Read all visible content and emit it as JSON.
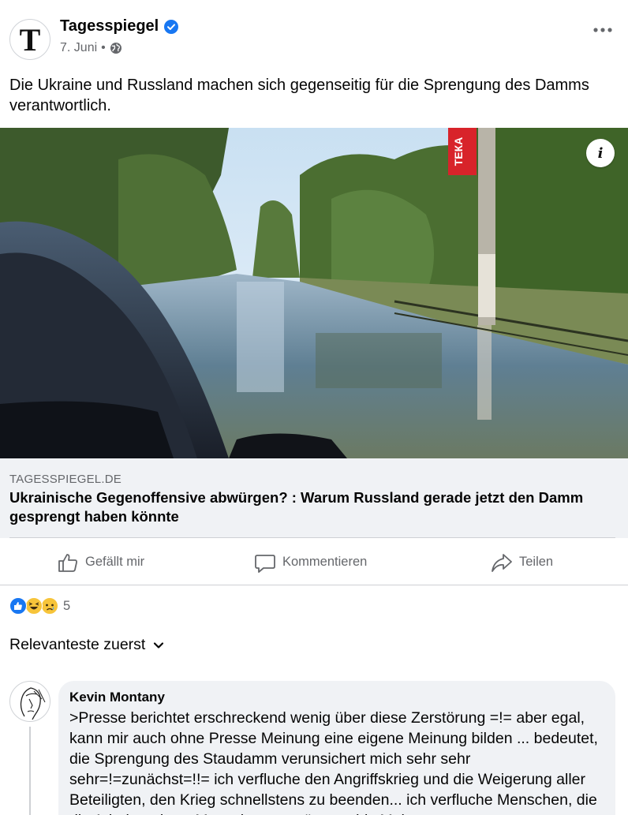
{
  "post": {
    "page_name": "Tagesspiegel",
    "avatar_letter": "T",
    "date": "7. Juni",
    "separator": "•",
    "text": "Die Ukraine und Russland machen sich gegenseitig für die Sprengung des Damms verantwortlich.",
    "image_sign_text": "ТЕКА",
    "info_label": "i"
  },
  "link": {
    "domain": "TAGESSPIEGEL.DE",
    "title": "Ukrainische Gegenoffensive abwürgen? : Warum Russland gerade jetzt den Damm gesprengt haben könnte"
  },
  "actions": {
    "like": "Gefällt mir",
    "comment": "Kommentieren",
    "share": "Teilen"
  },
  "reactions": {
    "types": [
      "like",
      "haha",
      "sad"
    ],
    "count": "5"
  },
  "sort": {
    "label": "Relevanteste zuerst"
  },
  "comment": {
    "author": "Kevin Montany",
    "text": ">Presse berichtet erschreckend wenig über diese Zerstörung =!= aber egal, kann mir auch ohne Presse Meinung eine eigene Meinung bilden ... bedeutet, die Sprengung des Staudamm verunsichert mich sehr sehr sehr=!=zunächst=!!= ich verfluche den Angriffskrieg und die Weigerung aller Beteiligten, den Krieg schnellstens zu beenden... ich verfluche Menschen, die die Arbeit anderer Menschen zerstören ... bis Mehr"
  },
  "colors": {
    "verified": "#1877f2",
    "secondary_text": "#65676b",
    "link_box_bg": "#f0f2f5",
    "like_blue": "#1877f2",
    "emoji_yellow": "#f7c43a"
  }
}
